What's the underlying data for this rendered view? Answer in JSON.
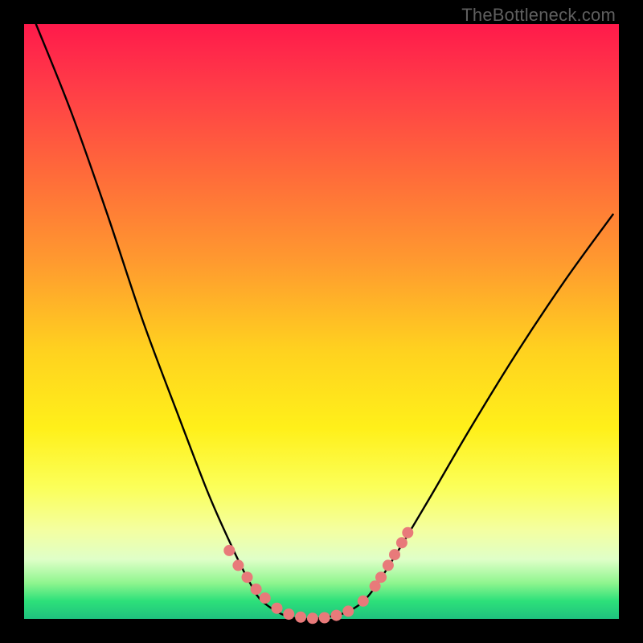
{
  "watermark": "TheBottleneck.com",
  "chart_data": {
    "type": "line",
    "title": "",
    "xlabel": "",
    "ylabel": "",
    "xlim": [
      0,
      1
    ],
    "ylim": [
      0,
      1
    ],
    "series": [
      {
        "name": "bottleneck-curve",
        "x": [
          0.02,
          0.08,
          0.14,
          0.2,
          0.26,
          0.31,
          0.35,
          0.38,
          0.4,
          0.44,
          0.48,
          0.52,
          0.55,
          0.58,
          0.62,
          0.68,
          0.75,
          0.83,
          0.91,
          0.99
        ],
        "y": [
          1.0,
          0.85,
          0.68,
          0.5,
          0.34,
          0.21,
          0.12,
          0.06,
          0.03,
          0.005,
          0.0,
          0.005,
          0.015,
          0.04,
          0.1,
          0.2,
          0.32,
          0.45,
          0.57,
          0.68
        ]
      }
    ],
    "markers": {
      "name": "highlight-dots",
      "color": "#e87a7a",
      "points": [
        {
          "x": 0.345,
          "y": 0.115
        },
        {
          "x": 0.36,
          "y": 0.09
        },
        {
          "x": 0.375,
          "y": 0.07
        },
        {
          "x": 0.39,
          "y": 0.05
        },
        {
          "x": 0.405,
          "y": 0.035
        },
        {
          "x": 0.425,
          "y": 0.018
        },
        {
          "x": 0.445,
          "y": 0.008
        },
        {
          "x": 0.465,
          "y": 0.003
        },
        {
          "x": 0.485,
          "y": 0.001
        },
        {
          "x": 0.505,
          "y": 0.002
        },
        {
          "x": 0.525,
          "y": 0.006
        },
        {
          "x": 0.545,
          "y": 0.013
        },
        {
          "x": 0.57,
          "y": 0.03
        },
        {
          "x": 0.59,
          "y": 0.055
        },
        {
          "x": 0.6,
          "y": 0.07
        },
        {
          "x": 0.612,
          "y": 0.09
        },
        {
          "x": 0.623,
          "y": 0.108
        },
        {
          "x": 0.635,
          "y": 0.128
        },
        {
          "x": 0.645,
          "y": 0.145
        }
      ]
    }
  }
}
